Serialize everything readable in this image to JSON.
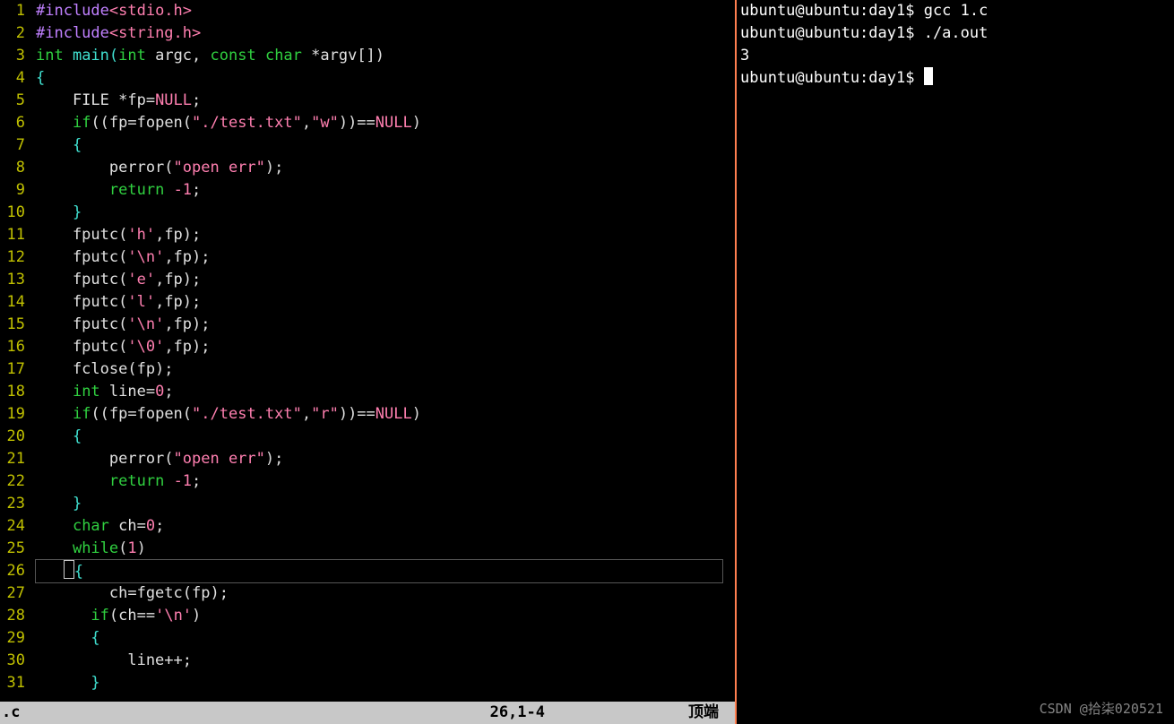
{
  "editor": {
    "filename": ".c",
    "cursor_pos": "26,1-4",
    "position_indicator": "顶端",
    "line_numbers": [
      "1",
      "2",
      "3",
      "4",
      "5",
      "6",
      "7",
      "8",
      "9",
      "10",
      "11",
      "12",
      "13",
      "14",
      "15",
      "16",
      "17",
      "18",
      "19",
      "20",
      "21",
      "22",
      "23",
      "24",
      "25",
      "26",
      "27",
      "28",
      "29",
      "30",
      "31"
    ],
    "lines": {
      "l1": {
        "pp": "#include",
        "inc": "<stdio.h>"
      },
      "l2": {
        "pp": "#include",
        "inc": "<string.h>"
      },
      "l3": {
        "a": "int",
        "b": " main(",
        "c": "int",
        "d": " argc, ",
        "e": "const",
        "f": " ",
        "g": "char",
        "h": " *argv[])"
      },
      "l4": "{",
      "l5": {
        "a": "    FILE *fp=",
        "b": "NULL",
        "c": ";"
      },
      "l6": {
        "a": "    ",
        "b": "if",
        "c": "((fp=fopen(",
        "d": "\"./test.txt\"",
        "e": ",",
        "f": "\"w\"",
        "g": "))==",
        "h": "NULL",
        "i": ")"
      },
      "l7": "    {",
      "l8": {
        "a": "        perror(",
        "b": "\"open err\"",
        "c": ");"
      },
      "l9": {
        "a": "        ",
        "b": "return",
        "c": " ",
        "d": "-1",
        "e": ";"
      },
      "l10": "    }",
      "l11": {
        "a": "    fputc(",
        "b": "'h'",
        "c": ",fp);"
      },
      "l12": {
        "a": "    fputc(",
        "b": "'\\n'",
        "c": ",fp);"
      },
      "l13": {
        "a": "    fputc(",
        "b": "'e'",
        "c": ",fp);"
      },
      "l14": {
        "a": "    fputc(",
        "b": "'l'",
        "c": ",fp);"
      },
      "l15": {
        "a": "    fputc(",
        "b": "'\\n'",
        "c": ",fp);"
      },
      "l16": {
        "a": "    fputc(",
        "b": "'\\0'",
        "c": ",fp);"
      },
      "l17": "    fclose(fp);",
      "l18": {
        "a": "    ",
        "b": "int",
        "c": " line=",
        "d": "0",
        "e": ";"
      },
      "l19": {
        "a": "    ",
        "b": "if",
        "c": "((fp=fopen(",
        "d": "\"./test.txt\"",
        "e": ",",
        "f": "\"r\"",
        "g": "))==",
        "h": "NULL",
        "i": ")"
      },
      "l20": "    {",
      "l21": {
        "a": "        perror(",
        "b": "\"open err\"",
        "c": ");"
      },
      "l22": {
        "a": "        ",
        "b": "return",
        "c": " ",
        "d": "-1",
        "e": ";"
      },
      "l23": "    }",
      "l24": {
        "a": "    ",
        "b": "char",
        "c": " ch=",
        "d": "0",
        "e": ";"
      },
      "l25": {
        "a": "    ",
        "b": "while",
        "c": "(",
        "d": "1",
        "e": ")"
      },
      "l26": "{",
      "l27": "        ch=fgetc(fp);",
      "l28": {
        "a": "      ",
        "b": "if",
        "c": "(ch==",
        "d": "'\\n'",
        "e": ")"
      },
      "l29": "      {",
      "l30": "          line++;",
      "l31": "      }"
    }
  },
  "terminal": {
    "prompt": "ubuntu@ubuntu:day1$ ",
    "lines": [
      {
        "cmd": "gcc 1.c"
      },
      {
        "cmd": "./a.out"
      },
      {
        "out": "3"
      },
      {
        "cmd": ""
      }
    ]
  },
  "watermark": "CSDN @拾柒020521"
}
